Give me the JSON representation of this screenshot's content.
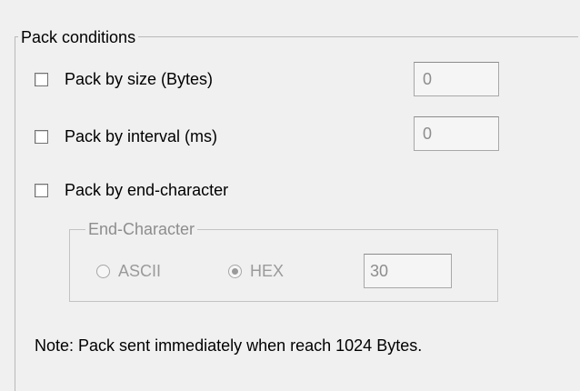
{
  "group": {
    "title": "Pack conditions"
  },
  "options": [
    {
      "label": "Pack by size (Bytes)",
      "checked": false,
      "value": "0"
    },
    {
      "label": "Pack by interval (ms)",
      "checked": false,
      "value": "0"
    },
    {
      "label": "Pack by end-character",
      "checked": false
    }
  ],
  "end_character": {
    "title": "End-Character",
    "ascii_label": "ASCII",
    "hex_label": "HEX",
    "selected": "HEX",
    "value": "30"
  },
  "note": "Note: Pack sent immediately when reach 1024 Bytes."
}
